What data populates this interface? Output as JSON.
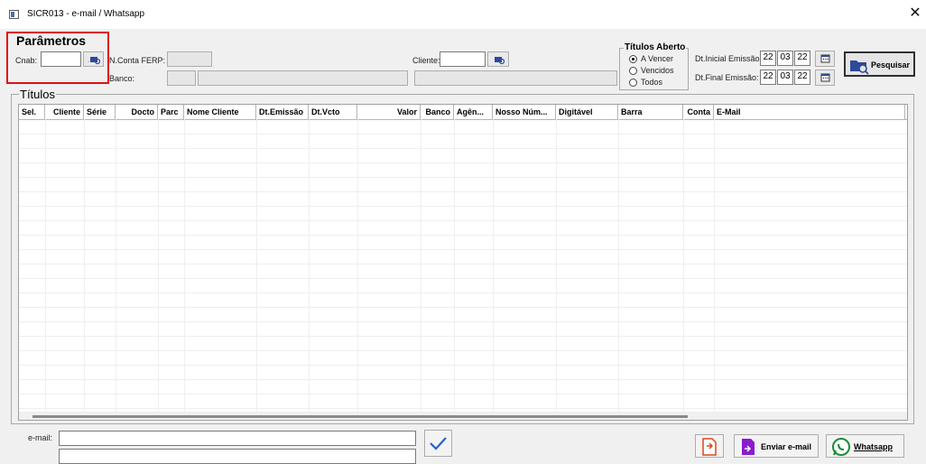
{
  "window": {
    "title": "SICR013 - e-mail / Whatsapp"
  },
  "params": {
    "group_title": "Parâmetros",
    "cnab_label": "Cnab:",
    "nconta_label": "N.Conta FERP:",
    "banco_label": "Banco:",
    "cliente_label": "Cliente:"
  },
  "titulos_aberto": {
    "title": "Títulos Aberto",
    "options": [
      "A Vencer",
      "Vencidos",
      "Todos"
    ],
    "selected": "A Vencer"
  },
  "dates": {
    "inicial_label": "Dt.Inicial Emissão:",
    "final_label": "Dt.Final Emissão:",
    "inicial": {
      "d": "22",
      "m": "03",
      "y": "22"
    },
    "final": {
      "d": "22",
      "m": "03",
      "y": "22"
    }
  },
  "search_button": "Pesquisar",
  "titulos": {
    "title": "Títulos",
    "columns": [
      "Sel.",
      "Cliente",
      "Série",
      "Docto",
      "Parc",
      "Nome Cliente",
      "Dt.Emissão",
      "Dt.Vcto",
      "Valor",
      "Banco",
      "Agên...",
      "Nosso Núm...",
      "Digitável",
      "Barra",
      "Conta",
      "E-Mail"
    ]
  },
  "footer": {
    "email_label": "e-mail:",
    "send_email_label": "Enviar e-mail",
    "whatsapp_label": "Whatsapp"
  },
  "colors": {
    "selection_box": "#e01010",
    "email_accent": "#8a1ccf",
    "pdf_accent": "#e0441b",
    "whatsapp_accent": "#1b8a3a",
    "check_accent": "#2a5fd0"
  }
}
